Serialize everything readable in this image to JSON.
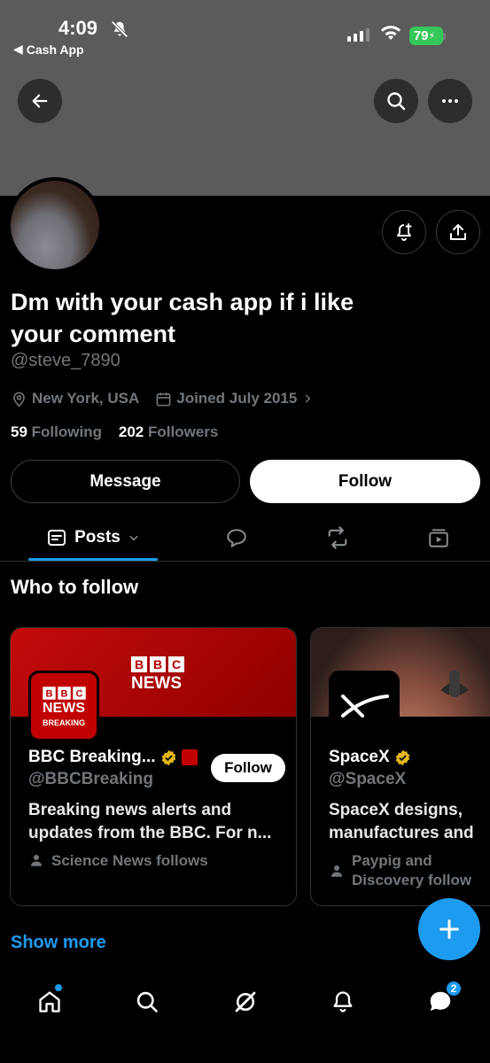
{
  "status_bar": {
    "time": "4:09",
    "back_app": "Cash App",
    "battery": "79"
  },
  "profile": {
    "display_name": "Dm with your cash app if i like your comment",
    "handle": "@steve_7890",
    "location": "New York, USA",
    "joined": "Joined July 2015",
    "following_count": "59",
    "following_label": "Following",
    "followers_count": "202",
    "followers_label": "Followers"
  },
  "actions": {
    "message": "Message",
    "follow": "Follow"
  },
  "tabs": {
    "posts": "Posts"
  },
  "who_to_follow": {
    "title": "Who to follow",
    "cards": [
      {
        "name": "BBC Breaking...",
        "handle": "@BBCBreaking",
        "bio_line1": "Breaking news alerts and",
        "bio_line2": "updates from the BBC. For n...",
        "social": "Science News follows",
        "follow": "Follow",
        "banner_logo_bbc": [
          "B",
          "B",
          "C"
        ],
        "banner_logo_news": "NEWS",
        "avatar_news": "NEWS",
        "avatar_breaking": "BREAKING"
      },
      {
        "name": "SpaceX",
        "handle": "@SpaceX",
        "bio_line1": "SpaceX designs,",
        "bio_line2": "manufactures and",
        "social_line1": "Paypig and",
        "social_line2": "Discovery follow"
      }
    ],
    "show_more": "Show more"
  },
  "bottom_nav": {
    "messages_badge": "2"
  },
  "colors": {
    "accent": "#1d9bf0",
    "bbc_red": "#b80000",
    "verified_gold": "#e2b719"
  }
}
